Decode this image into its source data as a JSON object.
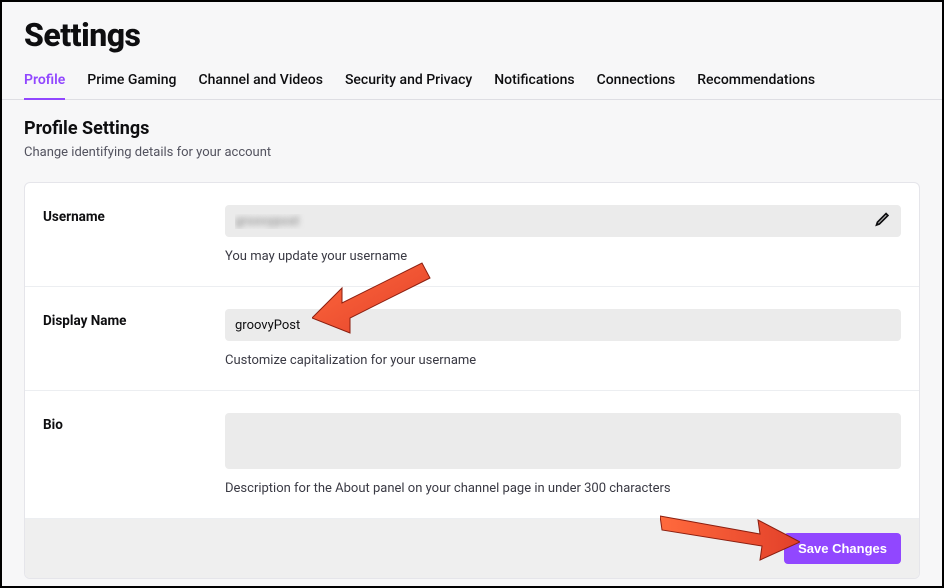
{
  "page_title": "Settings",
  "tabs": [
    {
      "label": "Profile",
      "active": true
    },
    {
      "label": "Prime Gaming",
      "active": false
    },
    {
      "label": "Channel and Videos",
      "active": false
    },
    {
      "label": "Security and Privacy",
      "active": false
    },
    {
      "label": "Notifications",
      "active": false
    },
    {
      "label": "Connections",
      "active": false
    },
    {
      "label": "Recommendations",
      "active": false
    }
  ],
  "section": {
    "title": "Profile Settings",
    "subtitle": "Change identifying details for your account"
  },
  "fields": {
    "username": {
      "label": "Username",
      "value": "groovypost",
      "helper": "You may update your username"
    },
    "display_name": {
      "label": "Display Name",
      "value": "groovyPost",
      "helper": "Customize capitalization for your username"
    },
    "bio": {
      "label": "Bio",
      "value": "",
      "helper": "Description for the About panel on your channel page in under 300 characters"
    }
  },
  "save_button": "Save Changes"
}
